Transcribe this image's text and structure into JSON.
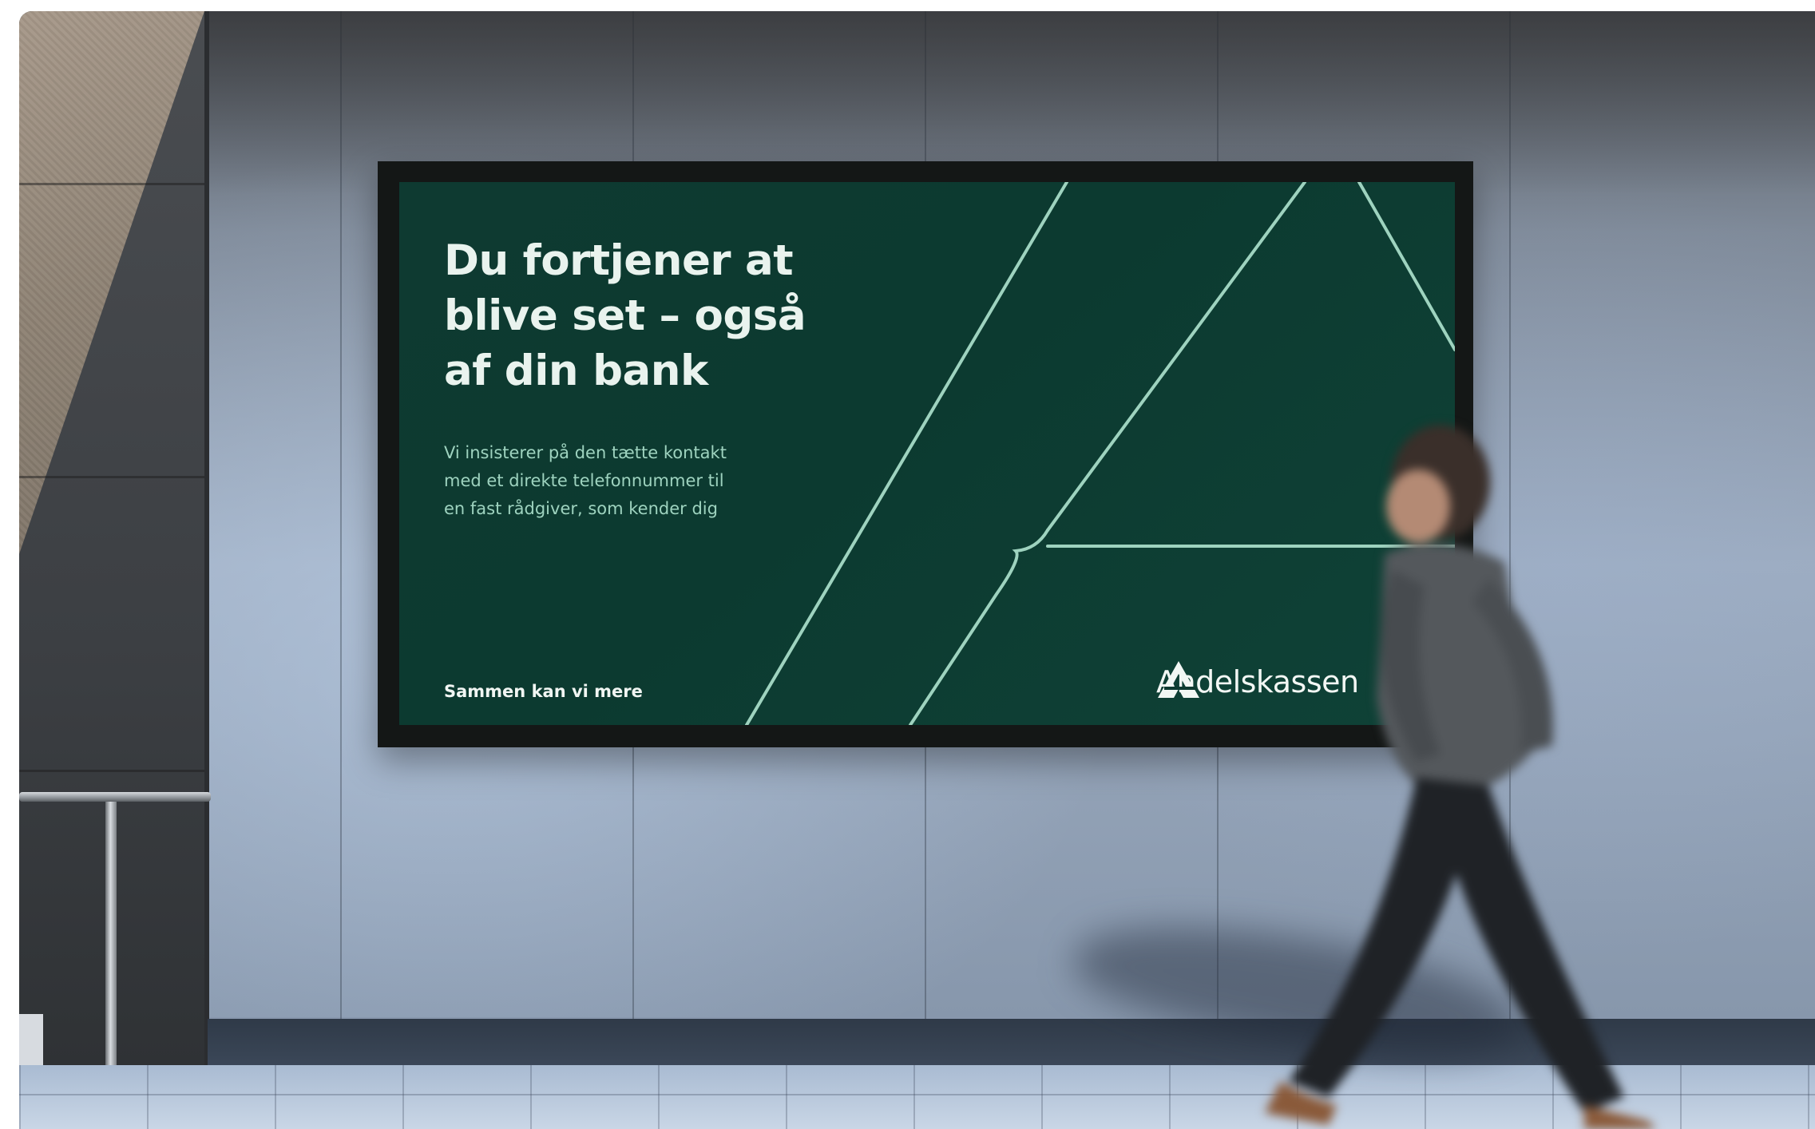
{
  "billboard": {
    "headline": "Du fortjener at\nblive set – også\naf din bank",
    "body": "Vi insisterer på den tætte kontakt\nmed et direkte telefonnummer til\nen fast rådgiver, som kender dig",
    "tagline": "Sammen kan vi mere",
    "brand_name": "Andelskassen",
    "logo_icon": "andelskassen-a-logo-icon"
  },
  "colors": {
    "billboard_green": "#0e3a31",
    "accent_mint": "#9ed3bf",
    "text_white": "#e9f3ee"
  }
}
